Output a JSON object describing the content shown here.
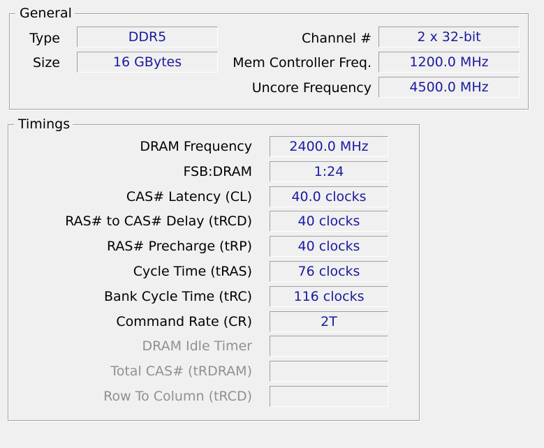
{
  "general": {
    "legend": "General",
    "type_label": "Type",
    "type_value": "DDR5",
    "size_label": "Size",
    "size_value": "16 GBytes",
    "channel_label": "Channel #",
    "channel_value": "2 x 32-bit",
    "mem_ctrl_label": "Mem Controller Freq.",
    "mem_ctrl_value": "1200.0 MHz",
    "uncore_label": "Uncore Frequency",
    "uncore_value": "4500.0 MHz"
  },
  "timings": {
    "legend": "Timings",
    "rows": [
      {
        "label": "DRAM Frequency",
        "value": "2400.0 MHz",
        "enabled": true
      },
      {
        "label": "FSB:DRAM",
        "value": "1:24",
        "enabled": true
      },
      {
        "label": "CAS# Latency (CL)",
        "value": "40.0 clocks",
        "enabled": true
      },
      {
        "label": "RAS# to CAS# Delay (tRCD)",
        "value": "40 clocks",
        "enabled": true
      },
      {
        "label": "RAS# Precharge (tRP)",
        "value": "40 clocks",
        "enabled": true
      },
      {
        "label": "Cycle Time (tRAS)",
        "value": "76 clocks",
        "enabled": true
      },
      {
        "label": "Bank Cycle Time (tRC)",
        "value": "116 clocks",
        "enabled": true
      },
      {
        "label": "Command Rate (CR)",
        "value": "2T",
        "enabled": true
      },
      {
        "label": "DRAM Idle Timer",
        "value": "",
        "enabled": false
      },
      {
        "label": "Total CAS# (tRDRAM)",
        "value": "",
        "enabled": false
      },
      {
        "label": "Row To Column (tRCD)",
        "value": "",
        "enabled": false
      }
    ]
  }
}
